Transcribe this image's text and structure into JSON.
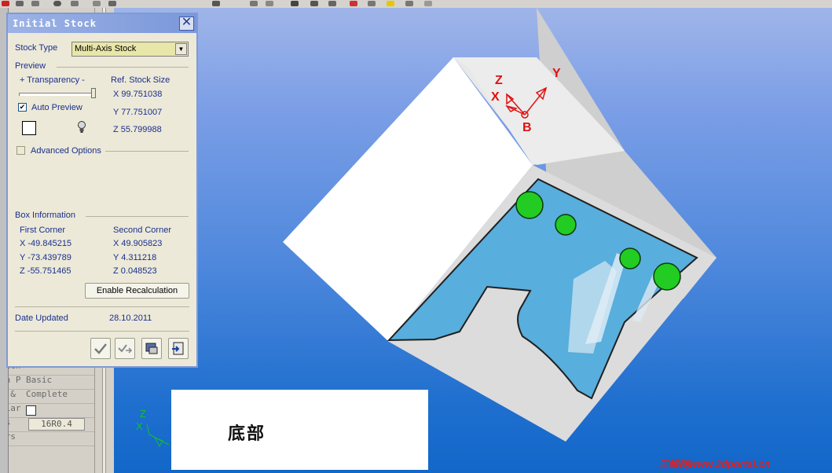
{
  "dialog": {
    "title": "Initial Stock",
    "close_label": "✕",
    "stock_type_label": "Stock Type",
    "stock_type_value": "Multi-Axis Stock",
    "preview_label": "Preview",
    "transparency_label": "+  Transparency    -",
    "transparency_level": 1.0,
    "auto_preview_label": "Auto Preview",
    "auto_preview_checked": true,
    "ref_stock_size_label": "Ref. Stock Size",
    "ref_size": {
      "x": "X  99.751038",
      "y": "Y  77.751007",
      "z": "Z  55.799988"
    },
    "advanced_options_label": "Advanced Options",
    "box_info_label": "Box Information",
    "first_corner_label": "First Corner",
    "second_corner_label": "Second Corner",
    "first_corner": {
      "x": "X  -49.845215",
      "y": "Y  -73.439789",
      "z": "Z  -55.751465"
    },
    "second_corner": {
      "x": "X  49.905823",
      "y": "Y  4.311218",
      "z": "Z  0.048523"
    },
    "enable_recalc_label": "Enable Recalculation",
    "date_updated_label": "Date Updated",
    "date_updated_value": "28.10.2011"
  },
  "properties": [
    {
      "key": "Mach",
      "value": ""
    },
    {
      "key": "en P",
      "value": "Basic"
    },
    {
      "key": "x &",
      "value": "Complete"
    },
    {
      "key": "liar",
      "value": ""
    },
    {
      "key": "rs",
      "value": "16R0.4"
    },
    {
      "key": "ers",
      "value": ""
    }
  ],
  "viewport": {
    "axis_labels": {
      "z": "Z",
      "x": "X",
      "y": "Y",
      "origin": "B"
    },
    "triad_labels": {
      "z": "Z",
      "x": "X"
    },
    "caption": "底部",
    "watermark": "三维网www.3dportal.cn"
  },
  "colors": {
    "accent": "#7a97d9",
    "stock_face": "#f2f2f2",
    "pocket": "#58aedc",
    "holes": "#22cc22",
    "axis": "#e01010"
  }
}
